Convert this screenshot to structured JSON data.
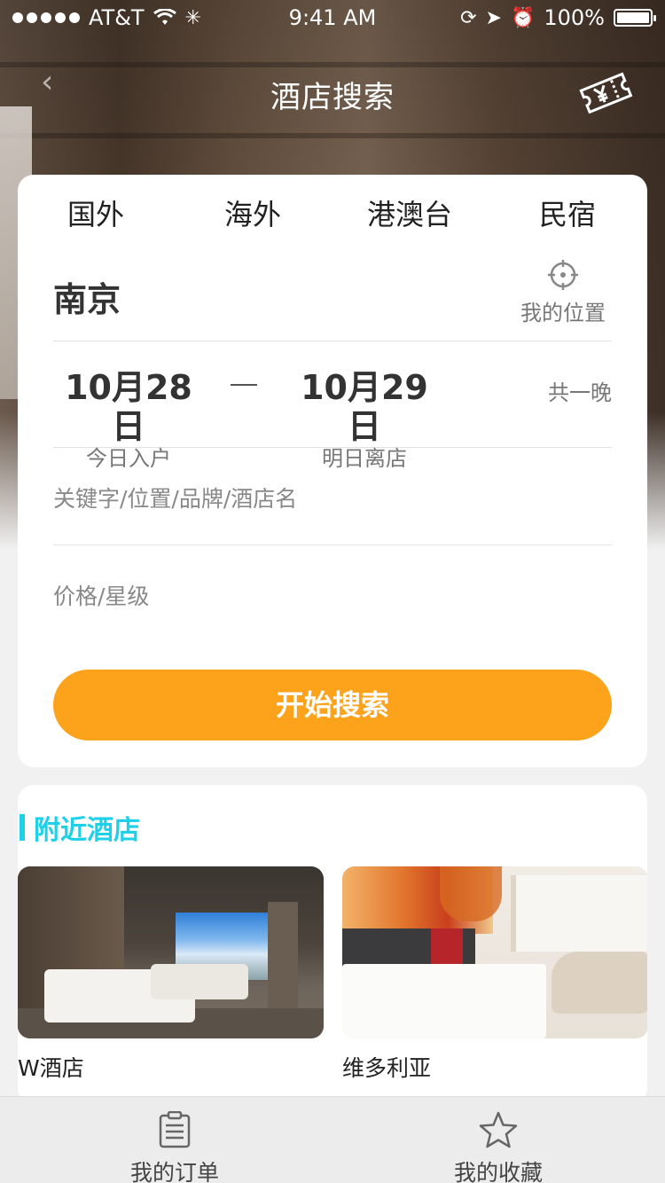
{
  "status_bar": {
    "carrier": "AT&T",
    "time": "9:41 AM",
    "battery": "100%",
    "battery_level": 1.0
  },
  "nav": {
    "title": "酒店搜索",
    "right_icon": "ticket-yen-icon"
  },
  "search": {
    "tabs": [
      "国外",
      "海外",
      "港澳台",
      "民宿"
    ],
    "city": "南京",
    "locate_label": "我的位置",
    "checkin": {
      "date": "10月28日",
      "label": "今日入户"
    },
    "checkout": {
      "date": "10月29日",
      "label": "明日离店"
    },
    "nights": "共一晚",
    "keyword_placeholder": "关键字/位置/品牌/酒店名",
    "price_placeholder": "价格/星级",
    "button_label": "开始搜索"
  },
  "nearby": {
    "title": "附近酒店",
    "hotels": [
      {
        "name": "W酒店"
      },
      {
        "name": "维多利亚"
      }
    ]
  },
  "tabbar": {
    "items": [
      {
        "label": "我的订单",
        "icon": "clipboard-icon"
      },
      {
        "label": "我的收藏",
        "icon": "star-icon"
      }
    ]
  },
  "colors": {
    "accent": "#fda21b",
    "section_accent": "#1ed0e8",
    "background": "#f1f1f1"
  }
}
